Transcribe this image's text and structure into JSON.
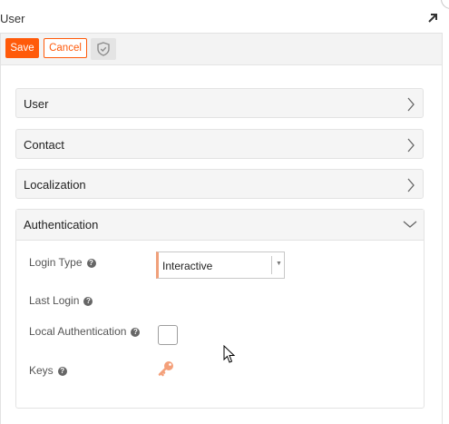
{
  "window": {
    "title": "User"
  },
  "toolbar": {
    "save_label": "Save",
    "cancel_label": "Cancel",
    "shield_icon": "shield-check-icon"
  },
  "sections": [
    {
      "label": "User",
      "expanded": false
    },
    {
      "label": "Contact",
      "expanded": false
    },
    {
      "label": "Localization",
      "expanded": false
    },
    {
      "label": "Authentication",
      "expanded": true
    }
  ],
  "authentication": {
    "login_type": {
      "label": "Login Type",
      "value": "Interactive"
    },
    "last_login": {
      "label": "Last Login",
      "value": ""
    },
    "local_auth": {
      "label": "Local Authentication",
      "checked": false
    },
    "keys": {
      "label": "Keys",
      "icon": "key-icon"
    }
  },
  "colors": {
    "accent": "#ff5a0a",
    "key_icon": "#f4a07a",
    "select_border_accent": "#f0a07a"
  }
}
